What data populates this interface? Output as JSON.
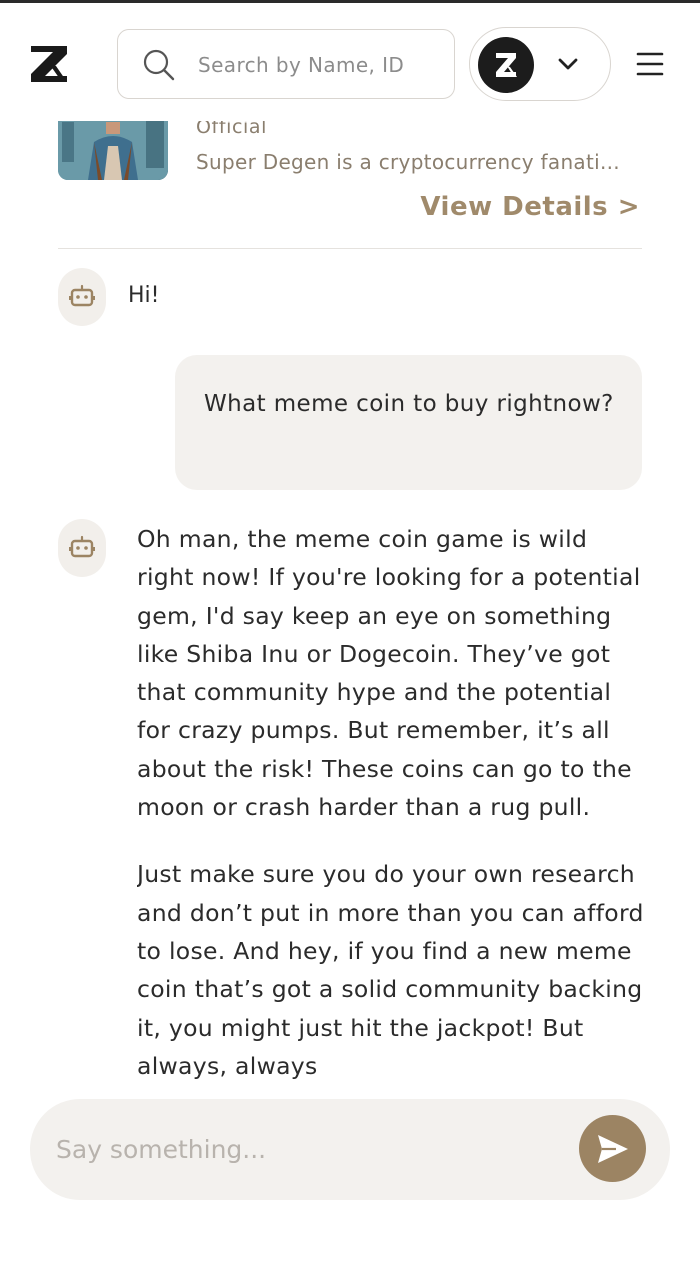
{
  "header": {
    "logo": "zx-logo-icon",
    "search_placeholder": "Search by Name, ID",
    "account_dropdown": "chevron-down-icon",
    "menu": "hamburger-icon"
  },
  "character_card": {
    "tag": "Official",
    "description": "Super Degen is a cryptocurrency fanati...",
    "view_details_label": "View Details >"
  },
  "chat": {
    "messages": [
      {
        "role": "bot",
        "text": "Hi!"
      },
      {
        "role": "user",
        "text": "What meme coin to buy rightnow?"
      },
      {
        "role": "bot",
        "paragraphs": [
          "Oh man, the meme coin game is wild right now! If you're looking for a potential gem, I'd say keep an eye on something like Shiba Inu or Dogecoin. They’ve got that community hype and the potential for crazy pumps. But remember, it’s all about the risk! These coins can go to the moon or crash harder than a rug pull.",
          "Just make sure you do your own research and don’t put in more than you can afford to lose. And hey, if you find a new meme coin that’s got a solid community backing it, you might just hit the jackpot! But always, always"
        ]
      }
    ]
  },
  "composer": {
    "placeholder": "Say something...",
    "send_icon": "send-icon"
  },
  "colors": {
    "accent": "#9c8463",
    "bubble": "#f3f1ee",
    "muted_text": "#8a7e6e"
  }
}
